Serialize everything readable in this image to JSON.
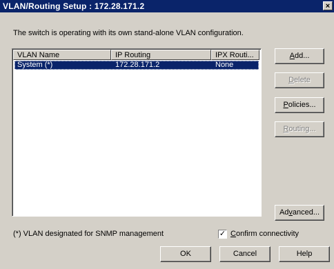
{
  "window": {
    "title": "VLAN/Routing Setup : 172.28.171.2",
    "close_glyph": "×"
  },
  "info_text": "The switch is operating with its own stand-alone VLAN configuration.",
  "table": {
    "columns": [
      "VLAN Name",
      "IP Routing",
      "IPX Routi..."
    ],
    "rows": [
      {
        "vlan_name": "System (*)",
        "ip_routing": "172.28.171.2",
        "ipx_routing": "None",
        "selected": true
      }
    ]
  },
  "buttons": {
    "add": {
      "label_pre": "",
      "label_key": "A",
      "label_post": "dd...",
      "enabled": true
    },
    "delete": {
      "label_pre": "",
      "label_key": "D",
      "label_post": "elete",
      "enabled": false
    },
    "policies": {
      "label_pre": "",
      "label_key": "P",
      "label_post": "olicies...",
      "enabled": true
    },
    "routing": {
      "label_pre": "",
      "label_key": "R",
      "label_post": "outing...",
      "enabled": false
    },
    "advanced": {
      "label_pre": "Ad",
      "label_key": "v",
      "label_post": "anced...",
      "enabled": true
    },
    "ok": "OK",
    "cancel": "Cancel",
    "help": "Help"
  },
  "footer": {
    "snmp_note": "(*) VLAN designated for SNMP management",
    "confirm_checked": true,
    "confirm_check_glyph": "✓",
    "confirm_label_key": "C",
    "confirm_label_post": "onfirm connectivity"
  }
}
